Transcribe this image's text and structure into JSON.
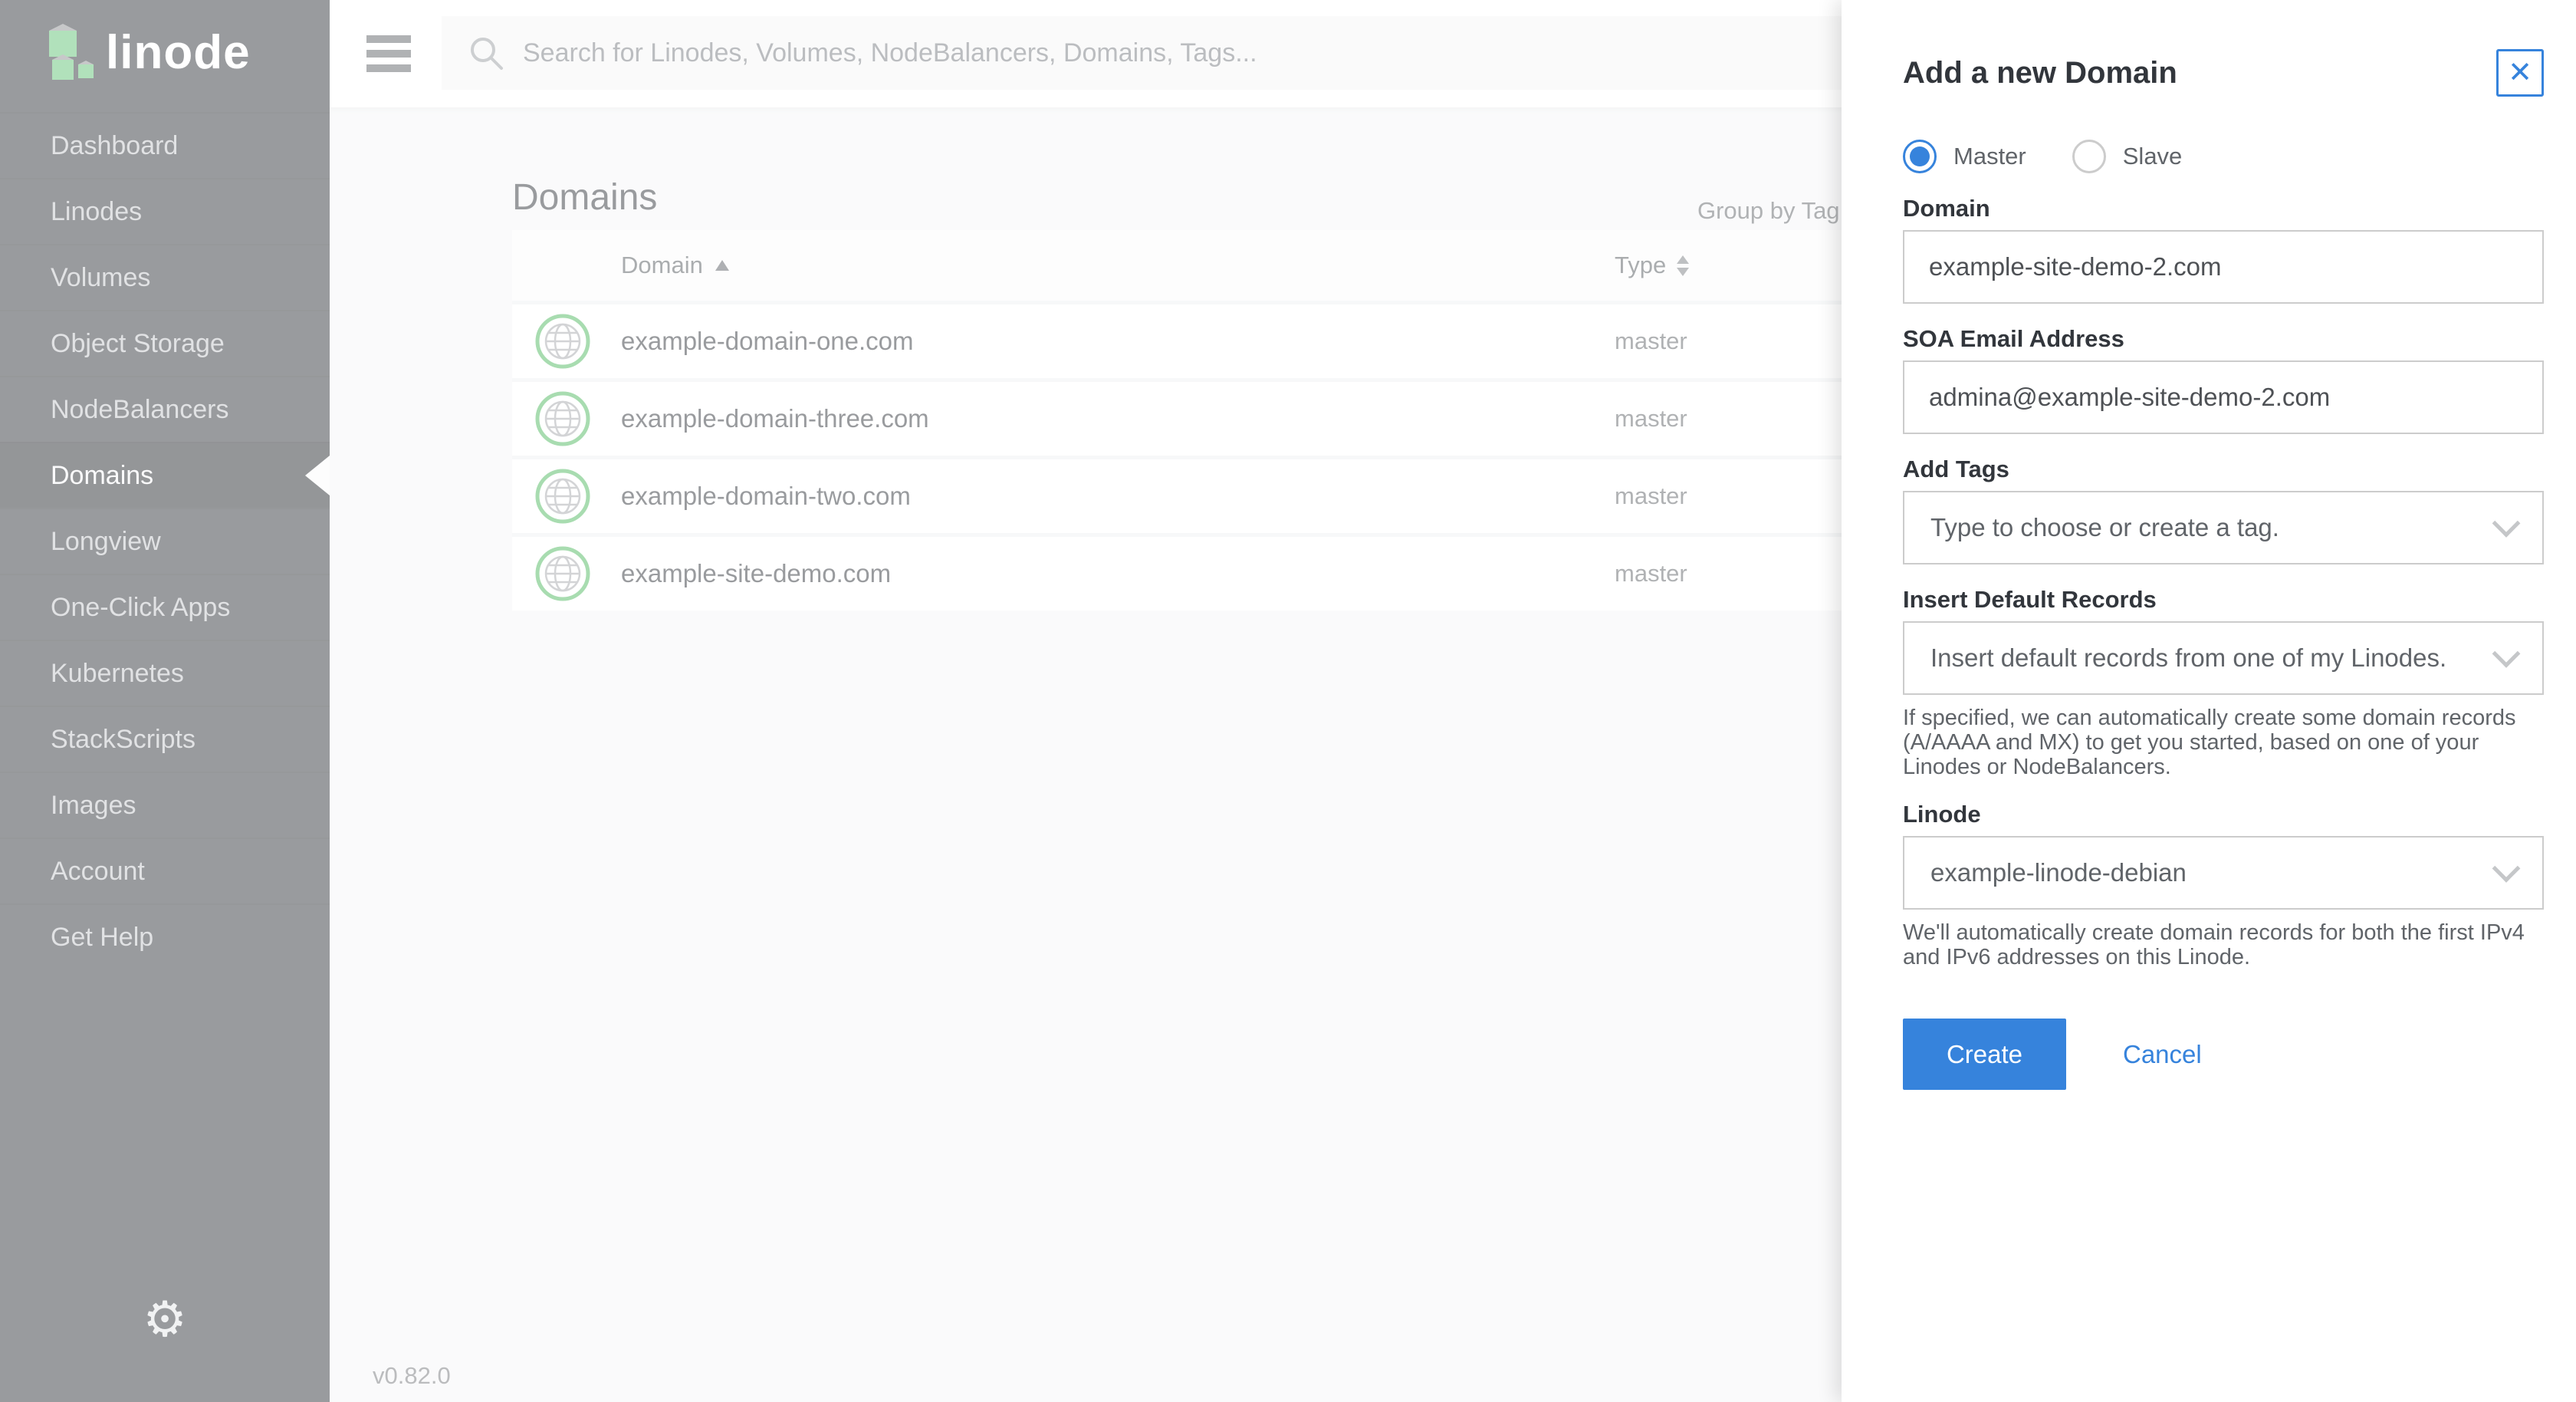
{
  "colors": {
    "accent_blue": "#3683DC",
    "brand_green": "#51B961",
    "sidebar_bg": "#32363C",
    "text_dark": "#32363C",
    "text_gray": "#606469"
  },
  "sidebar": {
    "logo_text": "linode",
    "items": [
      {
        "label": "Dashboard"
      },
      {
        "label": "Linodes"
      },
      {
        "label": "Volumes"
      },
      {
        "label": "Object Storage"
      },
      {
        "label": "NodeBalancers"
      },
      {
        "label": "Domains",
        "active": true
      },
      {
        "label": "Longview"
      },
      {
        "label": "One-Click Apps"
      },
      {
        "label": "Kubernetes"
      },
      {
        "label": "StackScripts"
      },
      {
        "label": "Images"
      },
      {
        "label": "Account"
      },
      {
        "label": "Get Help"
      }
    ]
  },
  "topbar": {
    "search_placeholder": "Search for Linodes, Volumes, NodeBalancers, Domains, Tags..."
  },
  "main": {
    "title": "Domains",
    "group_by_tag_label": "Group by Tag:",
    "version": "v0.82.0",
    "table": {
      "columns": {
        "domain": "Domain",
        "type": "Type"
      },
      "rows": [
        {
          "domain": "example-domain-one.com",
          "type": "master"
        },
        {
          "domain": "example-domain-three.com",
          "type": "master"
        },
        {
          "domain": "example-domain-two.com",
          "type": "master"
        },
        {
          "domain": "example-site-demo.com",
          "type": "master"
        }
      ]
    }
  },
  "drawer": {
    "title": "Add a new Domain",
    "close_icon": "✕",
    "type_options": [
      {
        "label": "Master",
        "selected": true
      },
      {
        "label": "Slave",
        "selected": false
      }
    ],
    "domain_field": {
      "label": "Domain",
      "value": "example-site-demo-2.com"
    },
    "soa_field": {
      "label": "SOA Email Address",
      "value": "admina@example-site-demo-2.com"
    },
    "tags_field": {
      "label": "Add Tags",
      "placeholder": "Type to choose or create a tag."
    },
    "records_field": {
      "label": "Insert Default Records",
      "value": "Insert default records from one of my Linodes.",
      "helper": "If specified, we can automatically create some domain records (A/AAAA and MX) to get you started, based on one of your Linodes or NodeBalancers."
    },
    "linode_field": {
      "label": "Linode",
      "value": "example-linode-debian",
      "helper": "We'll automatically create domain records for both the first IPv4 and IPv6 addresses on this Linode."
    },
    "actions": {
      "create": "Create",
      "cancel": "Cancel"
    }
  }
}
